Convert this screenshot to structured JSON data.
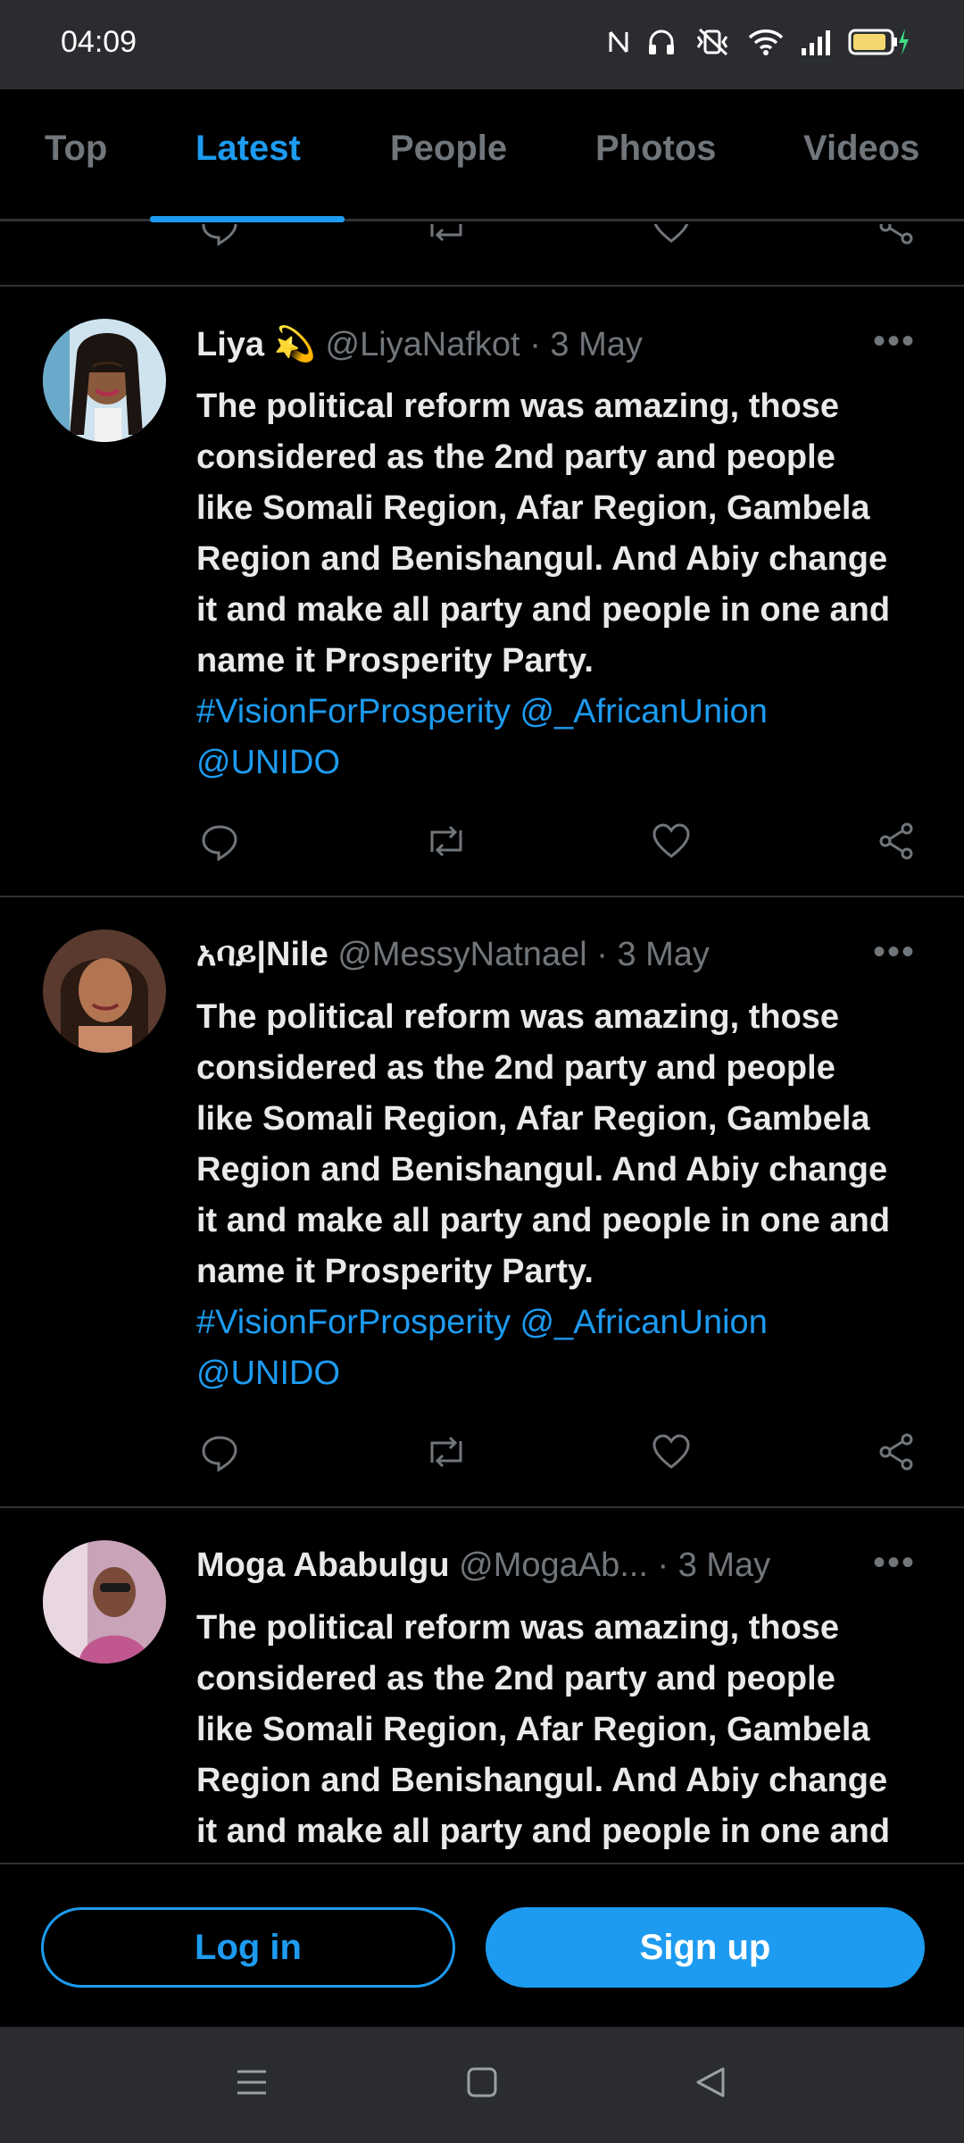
{
  "status": {
    "time": "04:09"
  },
  "tabs": [
    {
      "label": "Top"
    },
    {
      "label": "Latest"
    },
    {
      "label": "People"
    },
    {
      "label": "Photos"
    },
    {
      "label": "Videos"
    }
  ],
  "tweets": [
    {
      "name": "Liya",
      "emoji": "💫",
      "handle": "@LiyaNafkot",
      "date": "3 May",
      "text_lines": [
        "The political reform was amazing, those",
        "considered as the 2nd party and people",
        "like Somali Region, Afar Region, Gambela",
        "Region and Benishangul. And Abiy change",
        "it and make all party and people in one and",
        "name it Prosperity Party."
      ],
      "links_line1": "#VisionForProsperity @_AfricanUnion",
      "links_line2": "@UNIDO"
    },
    {
      "name": "አባይ|Nile",
      "handle": "@MessyNatnael",
      "date": "3 May",
      "text_lines": [
        "The political reform was amazing, those",
        "considered as the 2nd party and people",
        "like Somali Region, Afar Region, Gambela",
        "Region and Benishangul. And Abiy change",
        "it and make all party and people in one and",
        "name it Prosperity Party."
      ],
      "links_line1": "#VisionForProsperity @_AfricanUnion",
      "links_line2": "@UNIDO"
    },
    {
      "name": "Moga Ababulgu",
      "handle": "@MogaAb...",
      "date": "3 May",
      "text_lines": [
        "The political reform was amazing, those",
        "considered as the 2nd party and people",
        "like Somali Region, Afar Region, Gambela",
        "Region and Benishangul. And Abiy change",
        "it and make all party and people in one and"
      ]
    }
  ],
  "more_glyph": "•••",
  "dot_glyph": "·",
  "footer": {
    "login_label": "Log in",
    "signup_label": "Sign up"
  },
  "colors": {
    "accent": "#1d9bf0",
    "background": "#000000",
    "muted": "#71767b",
    "divider": "#2f3336"
  },
  "icons": [
    "comment-icon",
    "retweet-icon",
    "like-icon",
    "share-icon",
    "menu-icon",
    "home-square-icon",
    "back-triangle-icon"
  ]
}
